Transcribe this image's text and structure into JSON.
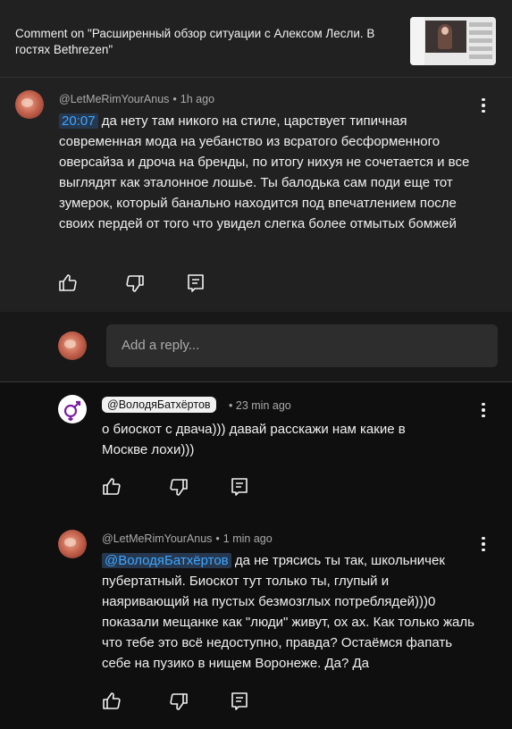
{
  "header": {
    "title": "Comment on \"Расширенный обзор ситуации с Алексом Лесли.  В гостях Bethrezen\""
  },
  "main_comment": {
    "author": "@LetMeRimYourAnus",
    "separator": "•",
    "time": "1h ago",
    "timestamp_link": "20:07",
    "text": " да нету там никого на стиле, царствует типичная современная мода на уебанство из всратого бесформенного оверсайза и дроча на бренды, по итогу нихуя не сочетается и все выглядят как эталонное лошье. Ты балодька сам поди еще тот зумерок, который банально находится под впечатлением после своих пердей от того что увидел слегка более отмытых бомжей"
  },
  "reply_box": {
    "placeholder": "Add a reply..."
  },
  "replies": [
    {
      "author": "@ВолодяБатхёртов",
      "separator": "•",
      "time": "23 min ago",
      "text": "о биоскот с двача))) давай расскажи нам какие в Москве лохи)))"
    },
    {
      "author": "@LetMeRimYourAnus",
      "separator": "•",
      "time": "1 min ago",
      "mention": "@ВолодяБатхёртов",
      "text": " да не трясись ты так, школьничек пубертатный. Биоскот тут только ты, глупый и наяривающий на пустых безмозглых потреблядей)))0 показали мещанке как \"люди\" живут, ох ах. Как только жаль что тебе это всё недоступно, правда? Остаёмся фапать себе на пузико в нищем Воронеже. Да? Да"
    }
  ],
  "icons": {
    "like": "thumbs-up-icon",
    "dislike": "thumbs-down-icon",
    "reply": "comment-reply-icon",
    "menu": "more-vert-icon"
  },
  "colors": {
    "background": "#0f0f0f",
    "surface": "#212121",
    "link": "#3ea6ff",
    "text": "#f1f1f1",
    "muted": "#aaaaaa"
  }
}
